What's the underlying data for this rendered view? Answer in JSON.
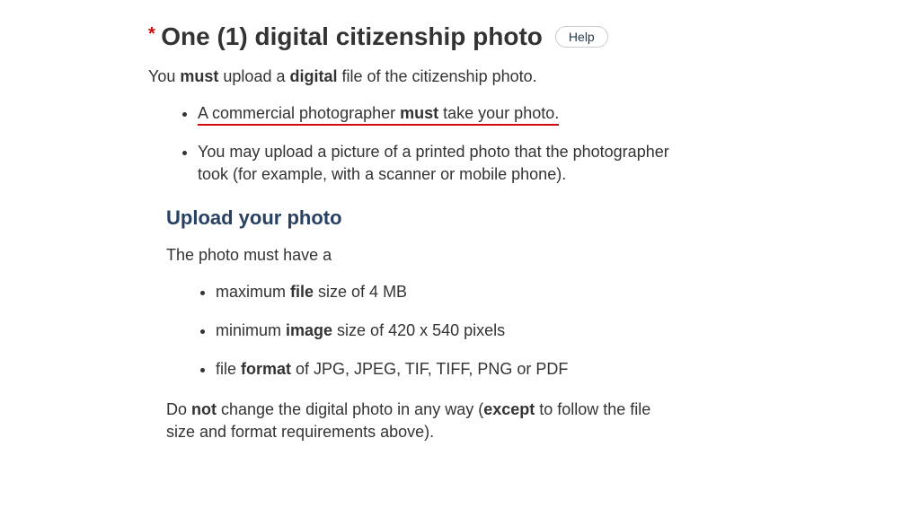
{
  "heading": {
    "asterisk": "*",
    "title": "One (1) digital citizenship photo",
    "help_label": "Help"
  },
  "intro": {
    "pre": "You ",
    "bold1": "must",
    "mid": " upload a ",
    "bold2": "digital",
    "post": " file of the citizenship photo."
  },
  "bullet1": {
    "pre": "A commercial photographer ",
    "bold": "must",
    "post": " take your photo."
  },
  "bullet2": "You may upload a picture of a printed photo that the photographer took (for example, with a scanner or mobile phone).",
  "subheading": "Upload your photo",
  "sub_intro": "The photo must have a",
  "req1": {
    "pre": "maximum ",
    "bold": "file",
    "post": " size of 4 MB"
  },
  "req2": {
    "pre": "minimum ",
    "bold": "image",
    "post": " size of 420 x 540 pixels"
  },
  "req3": {
    "pre": "file ",
    "bold": "format",
    "post": " of JPG, JPEG, TIF, TIFF, PNG or PDF"
  },
  "closing": {
    "pre": "Do ",
    "bold1": "not",
    "mid": " change the digital photo in any way (",
    "bold2": "except",
    "post": " to follow the file size and format requirements above)."
  }
}
